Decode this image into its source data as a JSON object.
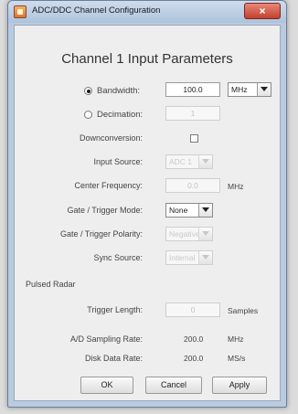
{
  "window": {
    "title": "ADC/DDC Channel Configuration",
    "close_symbol": "×"
  },
  "heading": "Channel 1 Input Parameters",
  "bandwidth": {
    "label": "Bandwidth:",
    "value": "100.0",
    "unit": "MHz",
    "selected": true
  },
  "decimation": {
    "label": "Decimation:",
    "value": "1",
    "selected": false
  },
  "downconversion": {
    "label": "Downconversion:",
    "checked": false
  },
  "input_source": {
    "label": "Input Source:",
    "value": "ADC 1"
  },
  "center_frequency": {
    "label": "Center Frequency:",
    "value": "0.0",
    "unit": "MHz"
  },
  "gate_trigger_mode": {
    "label": "Gate / Trigger Mode:",
    "value": "None"
  },
  "gate_trigger_polarity": {
    "label": "Gate / Trigger Polarity:",
    "value": "Negative"
  },
  "sync_source": {
    "label": "Sync Source:",
    "value": "Internal"
  },
  "pulsed_radar": {
    "label": "Pulsed Radar"
  },
  "trigger_length": {
    "label": "Trigger Length:",
    "value": "0",
    "unit": "Samples"
  },
  "ad_sampling_rate": {
    "label": "A/D Sampling Rate:",
    "value": "200.0",
    "unit": "MHz"
  },
  "disk_data_rate": {
    "label": "Disk Data Rate:",
    "value": "200.0",
    "unit": "MS/s"
  },
  "buttons": {
    "ok": "OK",
    "cancel": "Cancel",
    "apply": "Apply"
  }
}
